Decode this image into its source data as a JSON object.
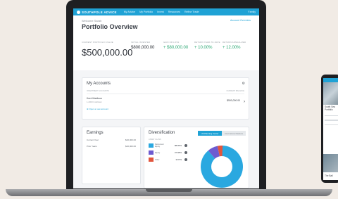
{
  "app": {
    "logo_text": "SOUTHPOLE ADVICE",
    "nav": [
      "My Advice",
      "My Portfolio",
      "Invest",
      "Resources",
      "Refine Trade"
    ],
    "user_label": "Family"
  },
  "header": {
    "welcome": "Welcome Sarah",
    "title": "Portfolio Overview",
    "add_account": "Account Overview"
  },
  "metrics": [
    {
      "label": "CURRENT PORTFOLIO VALUE",
      "value": "$500,000.00"
    },
    {
      "label": "INITIAL INVESTED",
      "value": "$800,000.00"
    },
    {
      "label": "GAIN OR LOSS",
      "value": "+ $80,000.00"
    },
    {
      "label": "RETURN YEAR-TO-DATE",
      "value": "+ 10.00%"
    },
    {
      "label": "RETURN ANNUALIZED",
      "value": "+ 12.00%"
    }
  ],
  "accounts": {
    "title": "My Accounts",
    "col_left": "INVESTMENT ACCOUNTS",
    "col_right": "CURRENT BALANCE",
    "row": {
      "name": "Kent Madison",
      "sub": "1-2003 Individual",
      "value": "$500,000.00"
    },
    "link": "Open a new account"
  },
  "earnings": {
    "title": "Earnings",
    "rows": [
      {
        "label": "Current Year",
        "value": "$20,000.00"
      },
      {
        "label": "Prior Years",
        "value": "$20,000.00"
      }
    ]
  },
  "diversification": {
    "title": "Diversification",
    "tabs": [
      "US Planning Center",
      "International Markets"
    ],
    "header": "ASSET CLASS",
    "items": [
      {
        "name": "Retirement Equity",
        "value": "88.85%",
        "color": "#2aa8e0",
        "fraction": 0.8885
      },
      {
        "name": "Equity",
        "value": "07.88%",
        "color": "#6d5bd0",
        "fraction": 0.0788
      },
      {
        "name": "Other",
        "value": "3.87%",
        "color": "#e2553d",
        "fraction": 0.0387
      }
    ]
  },
  "phone": {
    "title_line": "South Sea Portfolio",
    "footer": "The Ball"
  }
}
